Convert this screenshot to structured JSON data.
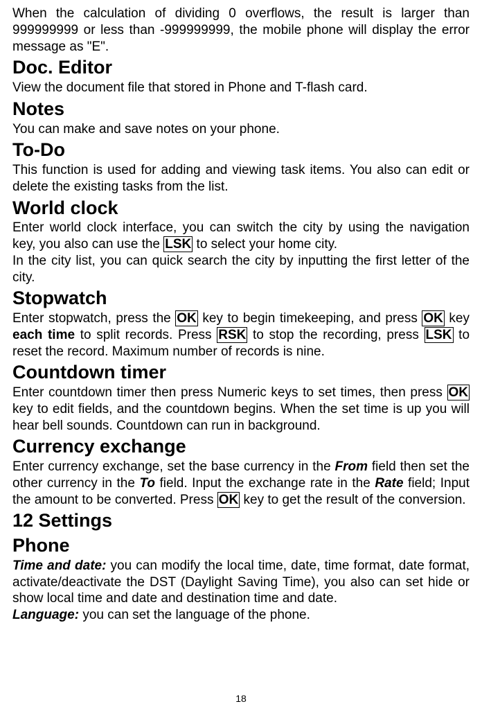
{
  "intro": {
    "overflow_text_part1": "When the calculation of dividing 0 overflows, the result is larger than 999999999 or less than -999999999, the mobile phone will display the error message as \"E\"."
  },
  "doc_editor": {
    "heading": "Doc. Editor",
    "text": "View the document file that stored in Phone and T-flash card."
  },
  "notes": {
    "heading": "Notes",
    "text": "You can make and save notes on your phone."
  },
  "todo": {
    "heading": "To-Do",
    "text": "This function is used for adding and viewing task items. You also can edit or delete the existing tasks from the list."
  },
  "world_clock": {
    "heading": "World clock",
    "text1_a": "Enter world clock interface, you can switch the city by using the navigation key, you also can use the ",
    "lsk": "LSK",
    "text1_b": " to select your home city.",
    "text2": "In the city list, you can quick search the city by inputting the first letter of the city."
  },
  "stopwatch": {
    "heading": "Stopwatch",
    "text_a": "Enter stopwatch, press the ",
    "ok1": "OK",
    "text_b": " key to begin timekeeping, and press ",
    "ok2": "OK",
    "text_c": " key ",
    "each_time": "each time",
    "text_d": " to split records. Press ",
    "rsk": "RSK",
    "text_e": " to stop the recording, press ",
    "lsk": "LSK",
    "text_f": " to reset the record. Maximum number of records is nine."
  },
  "countdown": {
    "heading": "Countdown timer",
    "text_a": "Enter countdown timer then press Numeric keys to set times, then press ",
    "ok": "OK",
    "text_b": " key to edit fields, and the countdown begins. When the set time is up you will hear bell sounds. Countdown can run in background."
  },
  "currency": {
    "heading": "Currency exchange",
    "text_a": "Enter currency exchange, set the base currency in the ",
    "from": "From",
    "text_b": " field then set the other currency in the ",
    "to": "To",
    "text_c": " field. Input the exchange rate in the ",
    "rate": "Rate",
    "text_d": " field; Input the amount to be converted. Press ",
    "ok": "OK",
    "text_e": " key to get the result of the conversion."
  },
  "settings": {
    "heading": "12 Settings"
  },
  "phone": {
    "heading": "Phone",
    "time_date_label": "Time and date:",
    "time_date_text": " you can modify the local time, date, time format, date format, activate/deactivate the DST (Daylight Saving Time), you also can set hide or show local time and date and destination time and date.",
    "language_label": " Language:",
    "language_text": " you can set the language of the phone."
  },
  "page_number": "18"
}
